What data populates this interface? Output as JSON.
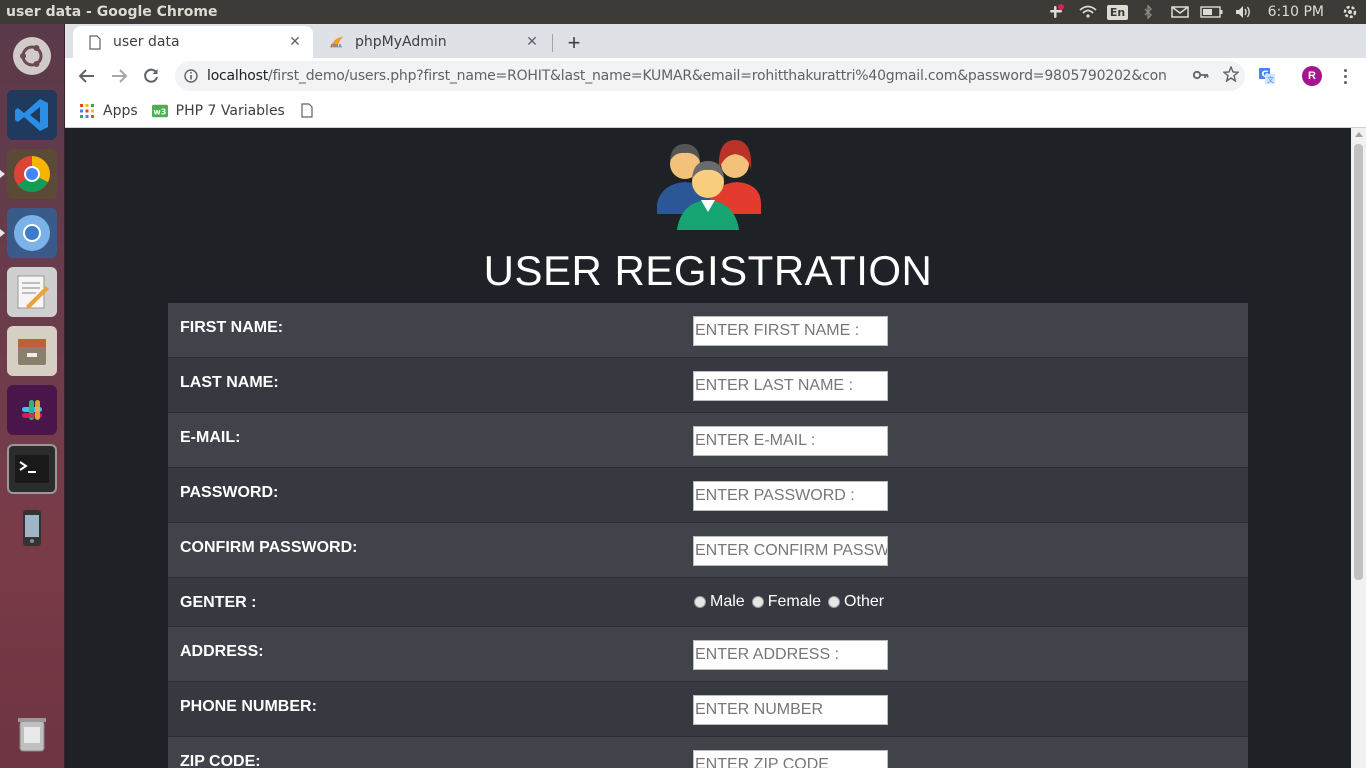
{
  "os": {
    "window_title": "user data - Google Chrome",
    "lang": "En",
    "time": "6:10 PM"
  },
  "launcher": {
    "items": [
      {
        "name": "ubuntu-dash"
      },
      {
        "name": "vscode"
      },
      {
        "name": "google-chrome"
      },
      {
        "name": "chromium"
      },
      {
        "name": "text-editor"
      },
      {
        "name": "files"
      },
      {
        "name": "slack"
      },
      {
        "name": "terminal"
      },
      {
        "name": "phone"
      },
      {
        "name": "trash"
      }
    ]
  },
  "browser": {
    "tabs": [
      {
        "title": "user data",
        "icon": "document-icon",
        "active": true
      },
      {
        "title": "phpMyAdmin",
        "icon": "pma-icon",
        "active": false
      }
    ],
    "url_host": "localhost",
    "url_path": "/first_demo/users.php?first_name=ROHIT&last_name=KUMAR&email=rohitthakurattri%40gmail.com&password=9805790202&confirm_pass...",
    "avatar_letter": "R",
    "bookmarks": [
      {
        "label": "Apps",
        "icon": "apps-grid-icon"
      },
      {
        "label": "PHP 7 Variables",
        "icon": "w3-icon"
      },
      {
        "label": "",
        "icon": "page-icon"
      }
    ]
  },
  "page": {
    "title": "USER REGISTRATION",
    "fields": [
      {
        "label": "FIRST NAME:",
        "placeholder": "ENTER FIRST NAME :"
      },
      {
        "label": "LAST NAME:",
        "placeholder": "ENTER LAST NAME :"
      },
      {
        "label": "E-MAIL:",
        "placeholder": "ENTER E-MAIL :"
      },
      {
        "label": "PASSWORD:",
        "placeholder": "ENTER PASSWORD :"
      },
      {
        "label": "CONFIRM PASSWORD:",
        "placeholder": "ENTER CONFIRM PASSWORD :"
      }
    ],
    "gender": {
      "label": "GENTER :",
      "options": [
        "Male",
        "Female",
        "Other"
      ]
    },
    "fields2": [
      {
        "label": "ADDRESS:",
        "placeholder": "ENTER ADDRESS :"
      },
      {
        "label": "PHONE NUMBER:",
        "placeholder": "ENTER NUMBER"
      },
      {
        "label": "ZIP CODE:",
        "placeholder": "ENTER ZIP CODE"
      }
    ]
  },
  "colors": {
    "page_bg": "#1e2126",
    "row_odd": "#404349",
    "row_even": "#363940"
  }
}
